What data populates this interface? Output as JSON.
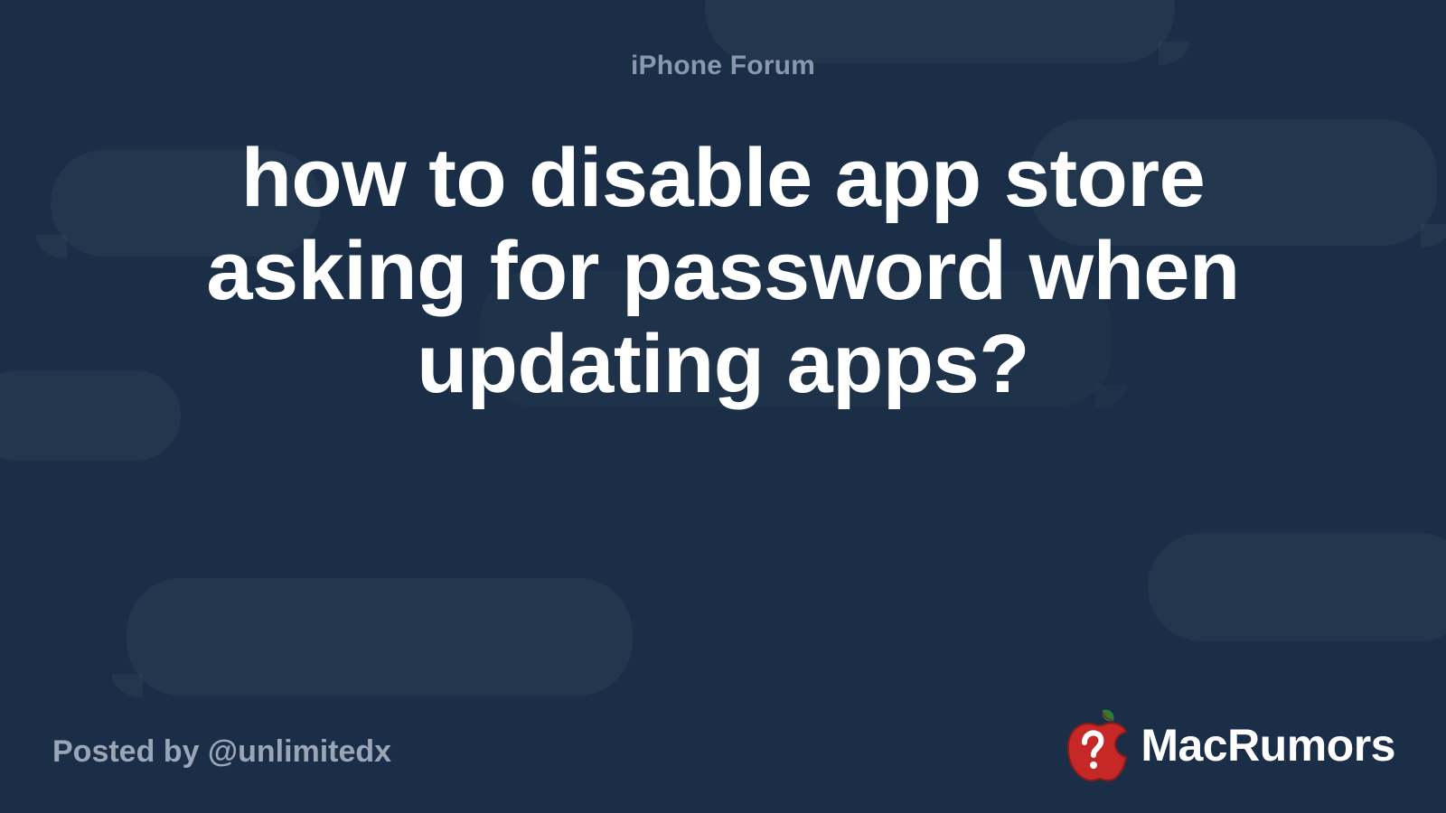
{
  "category": "iPhone Forum",
  "title": "how to disable app store asking for password when updating apps?",
  "byline": "Posted by @unlimitedx",
  "brand": {
    "name": "MacRumors"
  },
  "colors": {
    "background": "#1a2f47",
    "muted_text": "#8a98ab",
    "title_text": "#ffffff",
    "logo_red": "#c62828",
    "logo_leaf": "#2e7d32"
  }
}
